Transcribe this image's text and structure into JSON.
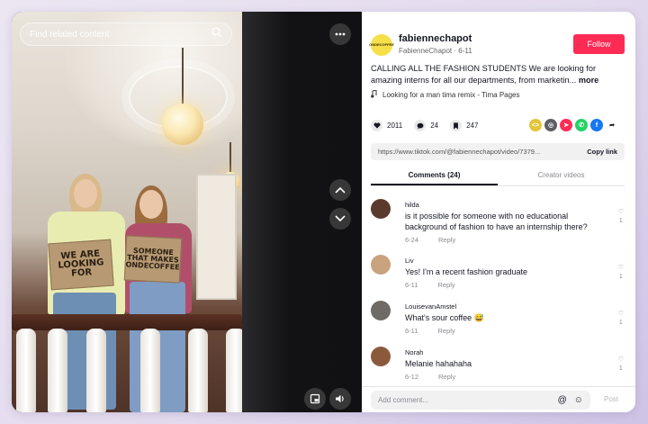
{
  "search": {
    "placeholder": "Find related content"
  },
  "video": {
    "sign_left": "WE ARE LOOKING FOR",
    "sign_right": "SOMEONE THAT MAKES ONDECOFFEE"
  },
  "author": {
    "avatar_text": "ONDECOFFEE",
    "username": "fabiennechapot",
    "subline": "FabienneChapot · 6-11",
    "follow_label": "Follow"
  },
  "caption": {
    "text": "CALLING ALL THE FASHION STUDENTS We are looking for amazing interns for all our departments, from marketin...",
    "more": "more"
  },
  "music": {
    "text": "Looking for a man tima remix - Tima Pages"
  },
  "stats": {
    "likes": "2011",
    "comments": "24",
    "saves": "247"
  },
  "link": {
    "url": "https://www.tiktok.com/@fabiennechapot/video/7379...",
    "copy_label": "Copy link"
  },
  "tabs": [
    {
      "label": "Comments (24)"
    },
    {
      "label": "Creator videos"
    }
  ],
  "comments": [
    {
      "name": "hilda",
      "text": "is it possible for someone with no educational background of fashion to have an internship there?",
      "date": "6-24",
      "reply": "Reply",
      "likes": "1",
      "avatar_color": "#5b3a2e"
    },
    {
      "name": "Liv",
      "text": "Yes! I'm a recent fashion graduate",
      "date": "6-11",
      "reply": "Reply",
      "likes": "1",
      "avatar_color": "#c9a27e"
    },
    {
      "name": "LouisevanAmstel",
      "text": "What's sour coffee 😅",
      "date": "6-11",
      "reply": "Reply",
      "likes": "1",
      "avatar_color": "#6e6a66"
    },
    {
      "name": "Norah",
      "text": "Melanie hahahaha",
      "date": "6-12",
      "reply": "Reply",
      "likes": "1",
      "avatar_color": "#8b5a3c"
    }
  ],
  "composer": {
    "placeholder": "Add comment...",
    "post_label": "Post"
  },
  "colors": {
    "accent": "#fe2c55",
    "brand_avatar": "#f5e04a"
  }
}
